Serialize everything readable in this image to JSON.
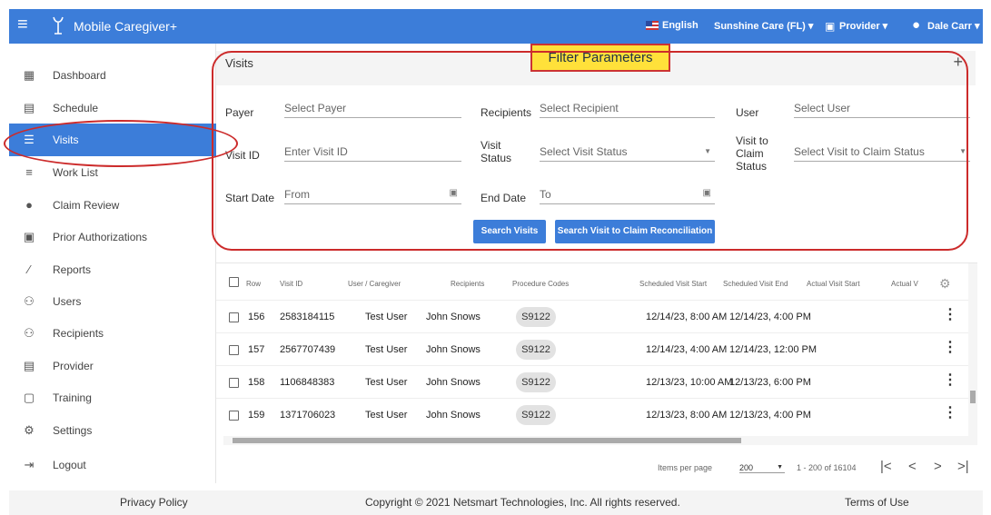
{
  "topbar": {
    "app_title": "Mobile Caregiver+",
    "language": "English",
    "agency": "Sunshine Care (FL) ▾",
    "role": "Provider ▾",
    "user": "Dale Carr ▾",
    "icons": [
      "menu-icon",
      "logo-icon",
      "flag-icon",
      "id-card-icon",
      "account-circle-icon"
    ]
  },
  "annotation": {
    "banner": "Filter Parameters"
  },
  "sidebar": {
    "items": [
      {
        "label": "Dashboard",
        "icon": "dashboard-icon",
        "glyph": "▦"
      },
      {
        "label": "Schedule",
        "icon": "calendar-icon",
        "glyph": "▤"
      },
      {
        "label": "Visits",
        "icon": "filter-icon",
        "glyph": "☰",
        "active": true
      },
      {
        "label": "Work List",
        "icon": "list-icon",
        "glyph": "≡"
      },
      {
        "label": "Claim Review",
        "icon": "alert-icon",
        "glyph": "●"
      },
      {
        "label": "Prior Authorizations",
        "icon": "calendar-check-icon",
        "glyph": "▣"
      },
      {
        "label": "Reports",
        "icon": "trend-icon",
        "glyph": "⁄"
      },
      {
        "label": "Users",
        "icon": "users-icon",
        "glyph": "⚇"
      },
      {
        "label": "Recipients",
        "icon": "recipients-icon",
        "glyph": "⚇"
      },
      {
        "label": "Provider",
        "icon": "clipboard-icon",
        "glyph": "▤"
      },
      {
        "label": "Training",
        "icon": "training-icon",
        "glyph": "▢"
      },
      {
        "label": "Settings",
        "icon": "gear-icon",
        "glyph": "⚙"
      },
      {
        "label": "Logout",
        "icon": "logout-icon",
        "glyph": "⇥"
      }
    ]
  },
  "visits": {
    "title": "Visits",
    "plus": "+",
    "filters": {
      "payer_label": "Payer",
      "payer_placeholder": "Select Payer",
      "recipients_label": "Recipients",
      "recipients_placeholder": "Select Recipient",
      "user_label": "User",
      "user_placeholder": "Select User",
      "visit_id_label": "Visit ID",
      "visit_id_placeholder": "Enter Visit ID",
      "visit_status_label": "Visit Status",
      "visit_status_placeholder": "Select Visit Status",
      "claim_status_label": "Visit to Claim Status",
      "claim_status_placeholder": "Select Visit to Claim Status",
      "start_date_label": "Start Date",
      "start_date_placeholder": "From",
      "end_date_label": "End Date",
      "end_date_placeholder": "To"
    },
    "buttons": {
      "search": "Search Visits",
      "reconcile": "Search Visit to Claim Reconciliation"
    }
  },
  "table": {
    "headers": [
      "Row",
      "Visit ID",
      "User / Caregiver",
      "Recipients",
      "Procedure Codes",
      "Scheduled Visit Start",
      "Scheduled Visit End",
      "Actual Visit Start",
      "Actual V"
    ],
    "rows": [
      {
        "row": "156",
        "visit_id": "2583184115",
        "user": "Test User",
        "recipient": "John Snows",
        "code": "S9122",
        "start": "12/14/23, 8:00 AM",
        "end": "12/14/23, 4:00 PM"
      },
      {
        "row": "157",
        "visit_id": "2567707439",
        "user": "Test User",
        "recipient": "John Snows",
        "code": "S9122",
        "start": "12/14/23, 4:00 AM",
        "end": "12/14/23, 12:00 PM"
      },
      {
        "row": "158",
        "visit_id": "1106848383",
        "user": "Test User",
        "recipient": "John Snows",
        "code": "S9122",
        "start": "12/13/23, 10:00 AM",
        "end": "12/13/23, 6:00 PM"
      },
      {
        "row": "159",
        "visit_id": "1371706023",
        "user": "Test User",
        "recipient": "John Snows",
        "code": "S9122",
        "start": "12/13/23, 8:00 AM",
        "end": "12/13/23, 4:00 PM"
      }
    ]
  },
  "pagination": {
    "items_per_page_label": "Items per page",
    "items_per_page": "200",
    "range": "1 - 200 of 16104"
  },
  "footer": {
    "privacy": "Privacy Policy",
    "copyright": "Copyright © 2021 Netsmart Technologies, Inc. All rights reserved.",
    "terms": "Terms of Use"
  },
  "colors": {
    "primary": "#3c7dd9",
    "annotation_red": "#cc2b2b",
    "banner_yellow": "#ffe13a"
  }
}
